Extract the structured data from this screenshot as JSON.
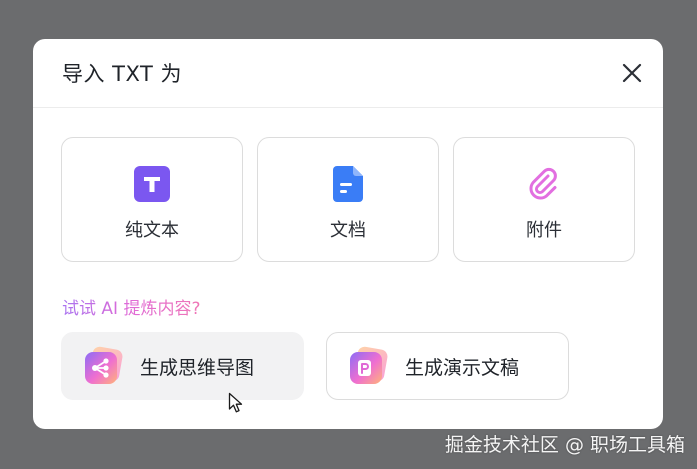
{
  "dialog": {
    "title": "导入 TXT 为",
    "close_icon": "close-icon"
  },
  "import_options": [
    {
      "label": "纯文本",
      "icon": "text-icon",
      "color": "#7b57f0"
    },
    {
      "label": "文档",
      "icon": "doc-icon",
      "color": "#3a7df6"
    },
    {
      "label": "附件",
      "icon": "paperclip-icon",
      "color": "#e26fe0"
    }
  ],
  "ai": {
    "hint": "试试 AI 提炼内容?",
    "actions": [
      {
        "label": "生成思维导图",
        "icon": "mindmap-icon"
      },
      {
        "label": "生成演示文稿",
        "icon": "slides-icon"
      }
    ]
  },
  "watermark": "掘金技术社区 @ 职场工具箱",
  "colors": {
    "backdrop": "#6b6c6e",
    "ai_gradient_start": "#a974f0",
    "ai_gradient_end": "#ef76b6"
  }
}
